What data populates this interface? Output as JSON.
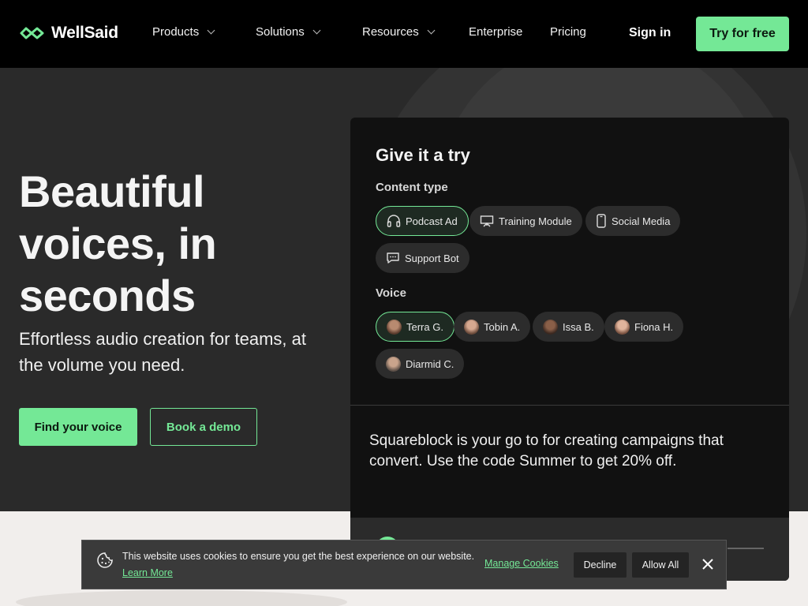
{
  "brand": {
    "name": "WellSaid",
    "accent": "#74e896"
  },
  "nav": {
    "items": [
      {
        "label": "Products"
      },
      {
        "label": "Solutions"
      },
      {
        "label": "Resources"
      },
      {
        "label": "Enterprise"
      },
      {
        "label": "Pricing"
      }
    ],
    "sign_in": "Sign in",
    "try_free": "Try for free"
  },
  "hero": {
    "headline": "Beautiful voices, in seconds",
    "subhead": "Effortless audio creation for teams, at the volume you need.",
    "primary_cta": "Find your voice",
    "secondary_cta": "Book a demo"
  },
  "demo": {
    "title": "Give it a try",
    "content_type_label": "Content type",
    "content_types": [
      {
        "label": "Podcast Ad",
        "icon": "headphones-icon",
        "selected": true
      },
      {
        "label": "Training Module",
        "icon": "presentation-icon",
        "selected": false
      },
      {
        "label": "Social Media",
        "icon": "phone-icon",
        "selected": false
      },
      {
        "label": "Support Bot",
        "icon": "chat-icon",
        "selected": false
      }
    ],
    "voice_label": "Voice",
    "voices": [
      {
        "label": "Terra G.",
        "selected": true
      },
      {
        "label": "Tobin A.",
        "selected": false
      },
      {
        "label": "Issa B.",
        "selected": false
      },
      {
        "label": "Fiona H.",
        "selected": false
      },
      {
        "label": "Diarmid C.",
        "selected": false
      }
    ],
    "sample_text": "Squareblock is your go to for creating campaigns that convert. Use the code Summer to get 20% off."
  },
  "cookie": {
    "message": "This website uses cookies to ensure you get the best experience on our website.",
    "learn_more": "Learn More",
    "manage": "Manage Cookies",
    "decline": "Decline",
    "allow": "Allow All"
  }
}
